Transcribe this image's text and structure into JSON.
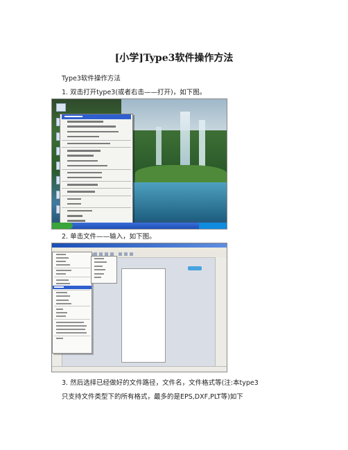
{
  "document": {
    "title": "[小学]Type3软件操作方法",
    "subtitle": "Type3软件操作方法",
    "steps": [
      "1. 双击打开type3(或者右击——打开)，如下图。",
      "2. 单击文件——输入，如下图。",
      "3. 然后选择已经做好的文件路径，文件名，文件格式等(注:本type3",
      "只支持文件类型下的所有格式，最多的是EPS,DXF,PLT等)如下"
    ]
  },
  "figures": {
    "fig1": "screenshot of desktop with right-click context menu",
    "fig2": "screenshot of Type3 application with File menu open"
  }
}
